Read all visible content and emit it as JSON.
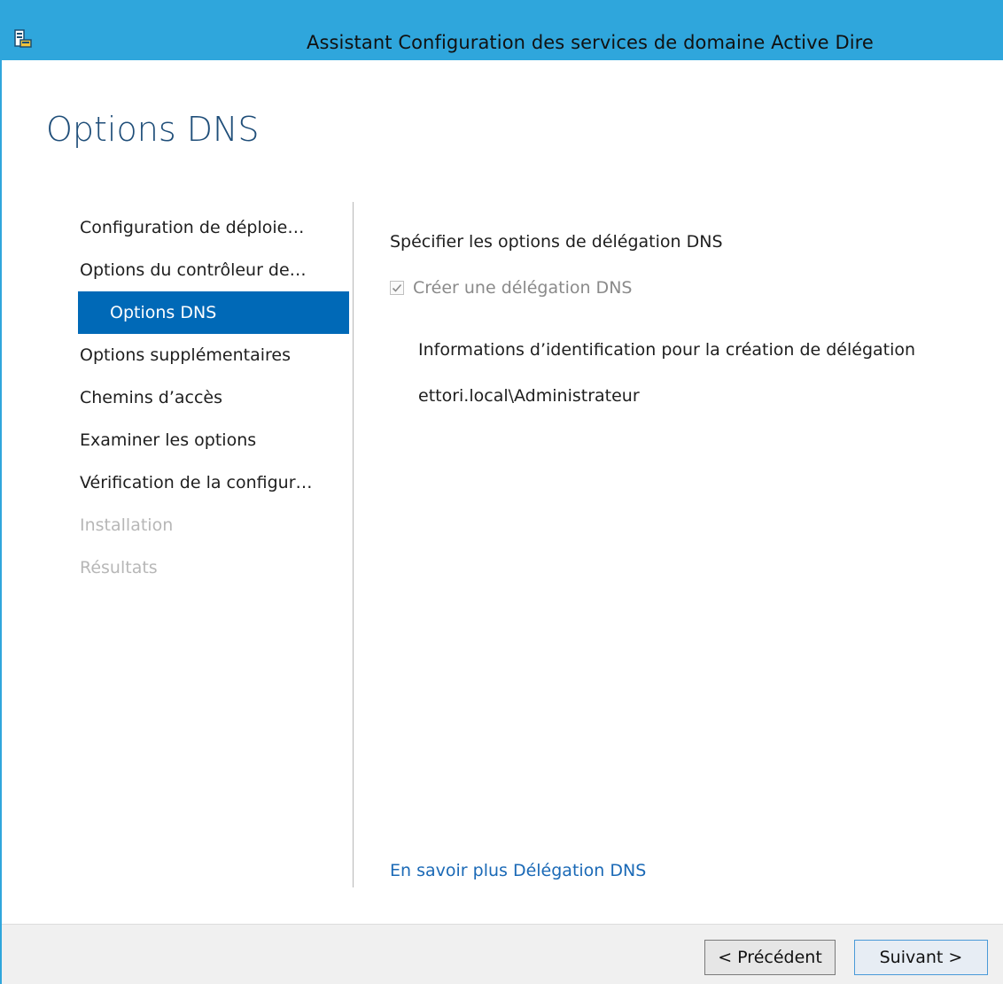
{
  "window": {
    "title": "Assistant Configuration des services de domaine Active Dire"
  },
  "page": {
    "title": "Options DNS"
  },
  "nav": {
    "items": [
      {
        "label": "Configuration de déploie…",
        "state": "normal"
      },
      {
        "label": "Options du contrôleur de…",
        "state": "normal"
      },
      {
        "label": "Options DNS",
        "state": "active"
      },
      {
        "label": "Options supplémentaires",
        "state": "normal"
      },
      {
        "label": "Chemins d’accès",
        "state": "normal"
      },
      {
        "label": "Examiner les options",
        "state": "normal"
      },
      {
        "label": "Vérification de la configur…",
        "state": "normal"
      },
      {
        "label": "Installation",
        "state": "disabled"
      },
      {
        "label": "Résultats",
        "state": "disabled"
      }
    ]
  },
  "content": {
    "section_label": "Spécifier les options de délégation DNS",
    "create_delegation": {
      "label": "Créer une délégation DNS",
      "checked": true,
      "enabled": false
    },
    "credentials_label": "Informations d’identification pour la création de délégation",
    "credentials_value": "ettori.local\\Administrateur",
    "learn_more_link": "En savoir plus Délégation DNS"
  },
  "footer": {
    "previous_button": "< Précédent",
    "next_button": "Suivant >"
  },
  "colors": {
    "titlebar": "#2fa6dc",
    "accent": "#0069b7",
    "page_title": "#1f4e79",
    "link": "#1a69b6",
    "disabled_text": "#b7b7b7"
  },
  "icons": {
    "app": "server-manager-icon",
    "check": "checkmark-icon"
  }
}
